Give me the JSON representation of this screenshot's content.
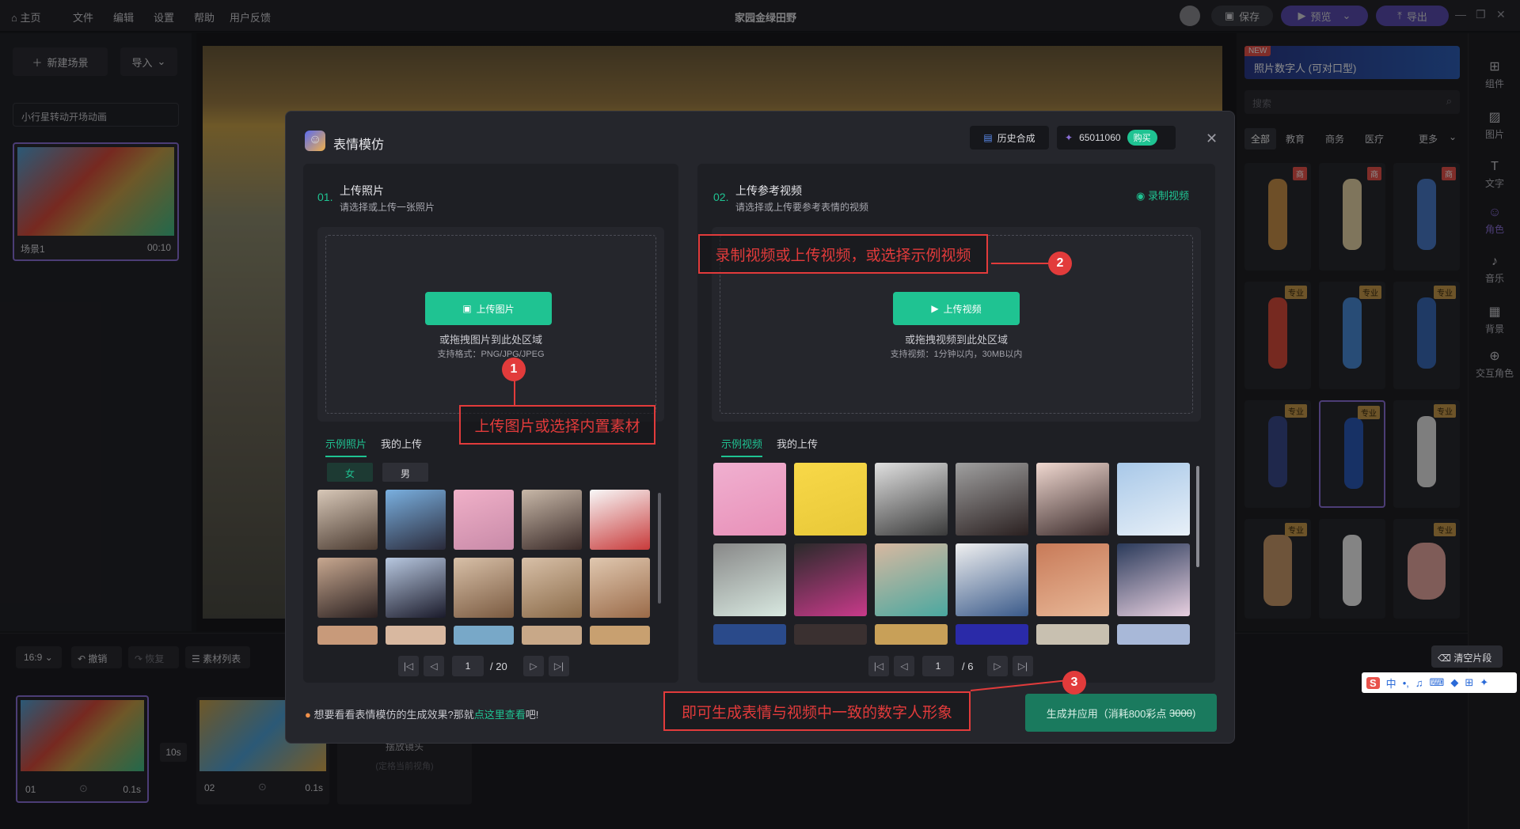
{
  "topbar": {
    "home": "主页",
    "menu": [
      "文件",
      "编辑",
      "设置",
      "帮助",
      "用户反馈"
    ],
    "title": "家园金绿田野",
    "save": "保存",
    "preview": "预览",
    "export": "导出"
  },
  "left": {
    "new_scene": "新建场景",
    "import": "导入",
    "dropdown": "小行星转动开场动画",
    "scene_label": "场景1",
    "scene_time": "00:10"
  },
  "right": {
    "banner_new": "NEW",
    "banner_text": "照片数字人 (可对口型)",
    "search_placeholder": "搜索",
    "tabs": [
      "全部",
      "教育",
      "商务",
      "医疗",
      "更多"
    ],
    "badge_shang": "商",
    "badge_pro": "专业"
  },
  "rail": [
    "组件",
    "图片",
    "文字",
    "角色",
    "音乐",
    "背景",
    "交互角色"
  ],
  "timeline": {
    "ratio": "16:9",
    "undo": "撤销",
    "redo": "恢复",
    "material_list": "素材列表",
    "clear": "清空片段",
    "clips": [
      {
        "name": "01",
        "dur": "0.1s"
      },
      {
        "name": "02",
        "dur": "0.1s"
      }
    ],
    "gap": "10s",
    "camera": "摆放镜头",
    "camera_sub": "(定格当前视角)"
  },
  "modal": {
    "title": "表情模仿",
    "history": "历史合成",
    "points": "65011060",
    "buy": "购买",
    "left": {
      "num": "01.",
      "title": "上传照片",
      "sub": "请选择或上传一张照片",
      "upload": "上传图片",
      "hint": "或拖拽图片到此处区域",
      "formats": "支持格式：PNG/JPG/JPEG",
      "tab_example": "示例照片",
      "tab_mine": "我的上传",
      "gender_f": "女",
      "gender_m": "男",
      "page": "1",
      "total": "/ 20"
    },
    "right": {
      "num": "02.",
      "title": "上传参考视频",
      "sub": "请选择或上传要参考表情的视频",
      "record": "录制视频",
      "upload": "上传视频",
      "hint": "或拖拽视频到此处区域",
      "formats": "支持视频：1分钟以内，30MB以内",
      "tab_example": "示例视频",
      "tab_mine": "我的上传",
      "page": "1",
      "total": "/ 6"
    },
    "footer_text_a": "想要看看表情模仿的生成效果?那就",
    "footer_link": "点这里查看",
    "footer_text_b": "吧!",
    "generate": "生成并应用（消耗800彩点",
    "generate_old": "3000",
    "generate_close": ")"
  },
  "annotations": {
    "n1": "1",
    "t1": "上传图片或选择内置素材",
    "n2": "2",
    "t2": "录制视频或上传视频，或选择示例视频",
    "n3": "3",
    "t3": "即可生成表情与视频中一致的数字人形象"
  },
  "ime": "中"
}
